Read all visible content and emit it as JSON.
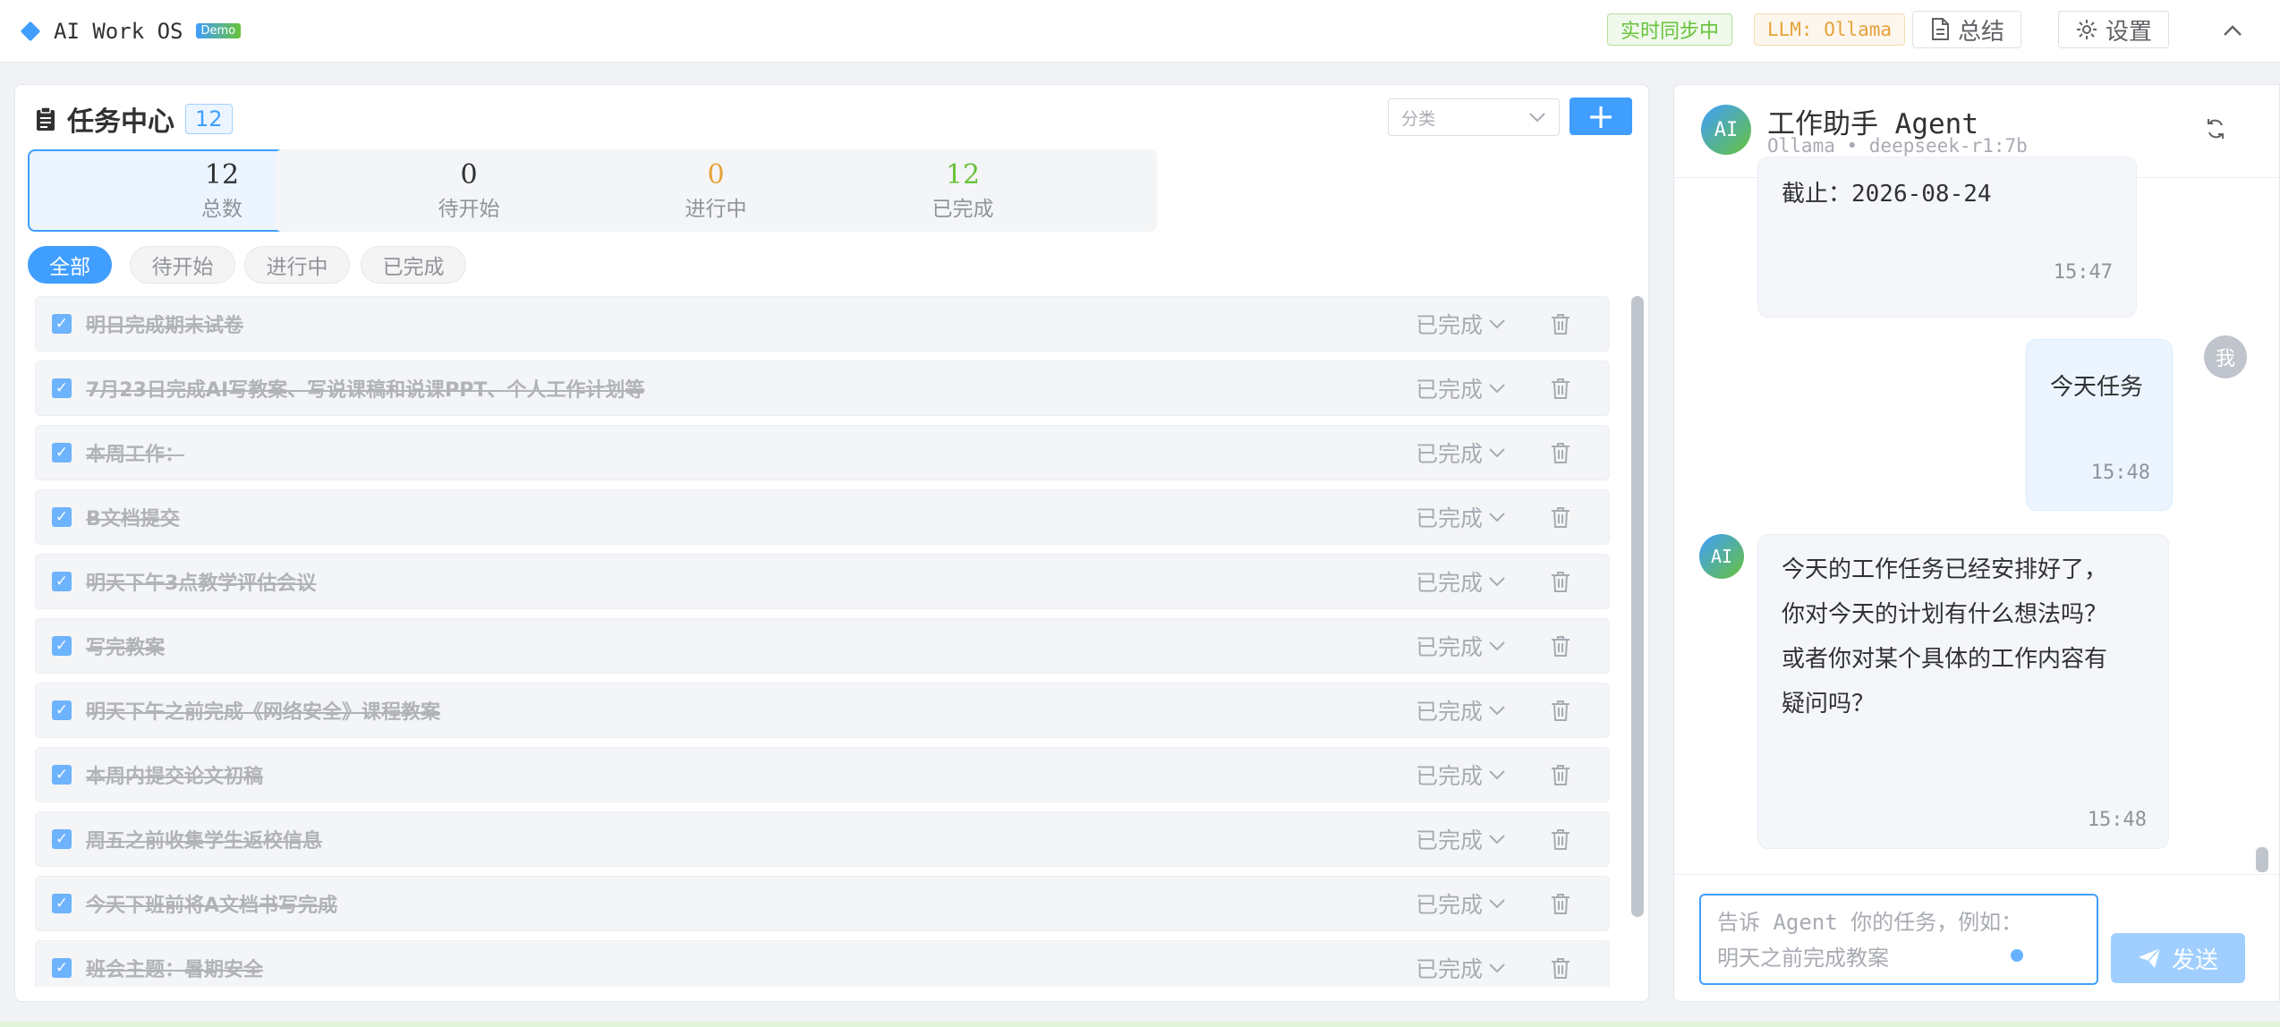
{
  "app": {
    "name": "AI Work OS",
    "badge": "Demo",
    "sync_tag": "实时同步中",
    "llm_tag": "LLM: Ollama",
    "summary_label": "总结",
    "settings_label": "设置"
  },
  "task_center": {
    "title": "任务中心",
    "count": "12",
    "category_placeholder": "分类",
    "add_label": "+",
    "stats": [
      {
        "value": "12",
        "label": "总数",
        "color": "#303133"
      },
      {
        "value": "0",
        "label": "待开始",
        "color": "#303133"
      },
      {
        "value": "0",
        "label": "进行中",
        "color": "#e6a23c"
      },
      {
        "value": "12",
        "label": "已完成",
        "color": "#67c23a"
      }
    ],
    "filters": [
      "全部",
      "待开始",
      "进行中",
      "已完成"
    ],
    "tasks": [
      {
        "title": "明日完成期末试卷",
        "status": "已完成"
      },
      {
        "title": "7月23日完成AI写教案、写说课稿和说课PPT、个人工作计划等",
        "status": "已完成"
      },
      {
        "title": "本周工作：",
        "status": "已完成"
      },
      {
        "title": "B文档提交",
        "status": "已完成"
      },
      {
        "title": "明天下午3点教学评估会议",
        "status": "已完成"
      },
      {
        "title": "写完教案",
        "status": "已完成"
      },
      {
        "title": "明天下午之前完成《网络安全》课程教案",
        "status": "已完成"
      },
      {
        "title": "本周内提交论文初稿",
        "status": "已完成"
      },
      {
        "title": "周五之前收集学生返校信息",
        "status": "已完成"
      },
      {
        "title": "今天下班前将A文档书写完成",
        "status": "已完成"
      },
      {
        "title": "班会主题：暑期安全",
        "status": "已完成"
      }
    ]
  },
  "chat": {
    "agent_avatar": "AI",
    "agent_name": "工作助手 Agent",
    "agent_sub": "Ollama • deepseek-r1:7b",
    "user_avatar": "我",
    "messages": [
      {
        "role": "agent",
        "text": "截止：2026-08-24",
        "time": "15:47"
      },
      {
        "role": "user",
        "text": "今天任务",
        "time": "15:48"
      },
      {
        "role": "agent",
        "lines": [
          "今天的工作任务已经安排好了，",
          "你对今天的计划有什么想法吗？",
          "或者你对某个具体的工作内容有",
          "疑问吗？"
        ],
        "time": "15:48"
      }
    ],
    "input_placeholder_line1": "告诉 Agent 你的任务，例如：",
    "input_placeholder_line2": "明天之前完成教案",
    "send_label": "发送"
  }
}
